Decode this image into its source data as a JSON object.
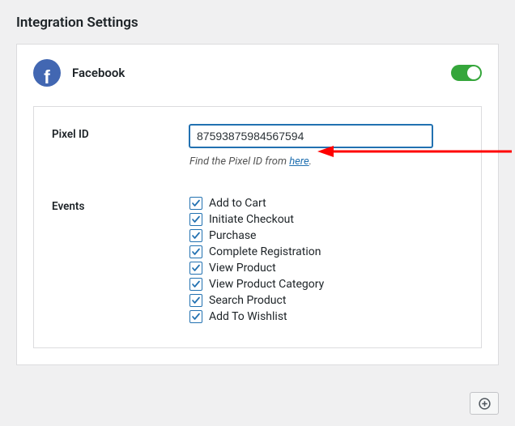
{
  "page": {
    "title": "Integration Settings"
  },
  "integration": {
    "name": "Facebook",
    "enabled": true
  },
  "pixel": {
    "label": "Pixel ID",
    "value": "87593875984567594",
    "helper_pre": "Find the Pixel ID from ",
    "helper_link": "here",
    "helper_post": "."
  },
  "events": {
    "label": "Events",
    "items": [
      {
        "label": "Add to Cart",
        "checked": true
      },
      {
        "label": "Initiate Checkout",
        "checked": true
      },
      {
        "label": "Purchase",
        "checked": true
      },
      {
        "label": "Complete Registration",
        "checked": true
      },
      {
        "label": "View Product",
        "checked": true
      },
      {
        "label": "View Product Category",
        "checked": true
      },
      {
        "label": "Search Product",
        "checked": true
      },
      {
        "label": "Add To Wishlist",
        "checked": true
      }
    ]
  },
  "colors": {
    "accent": "#2271b1",
    "toggle_on": "#35a63b",
    "arrow": "#ff0000"
  }
}
